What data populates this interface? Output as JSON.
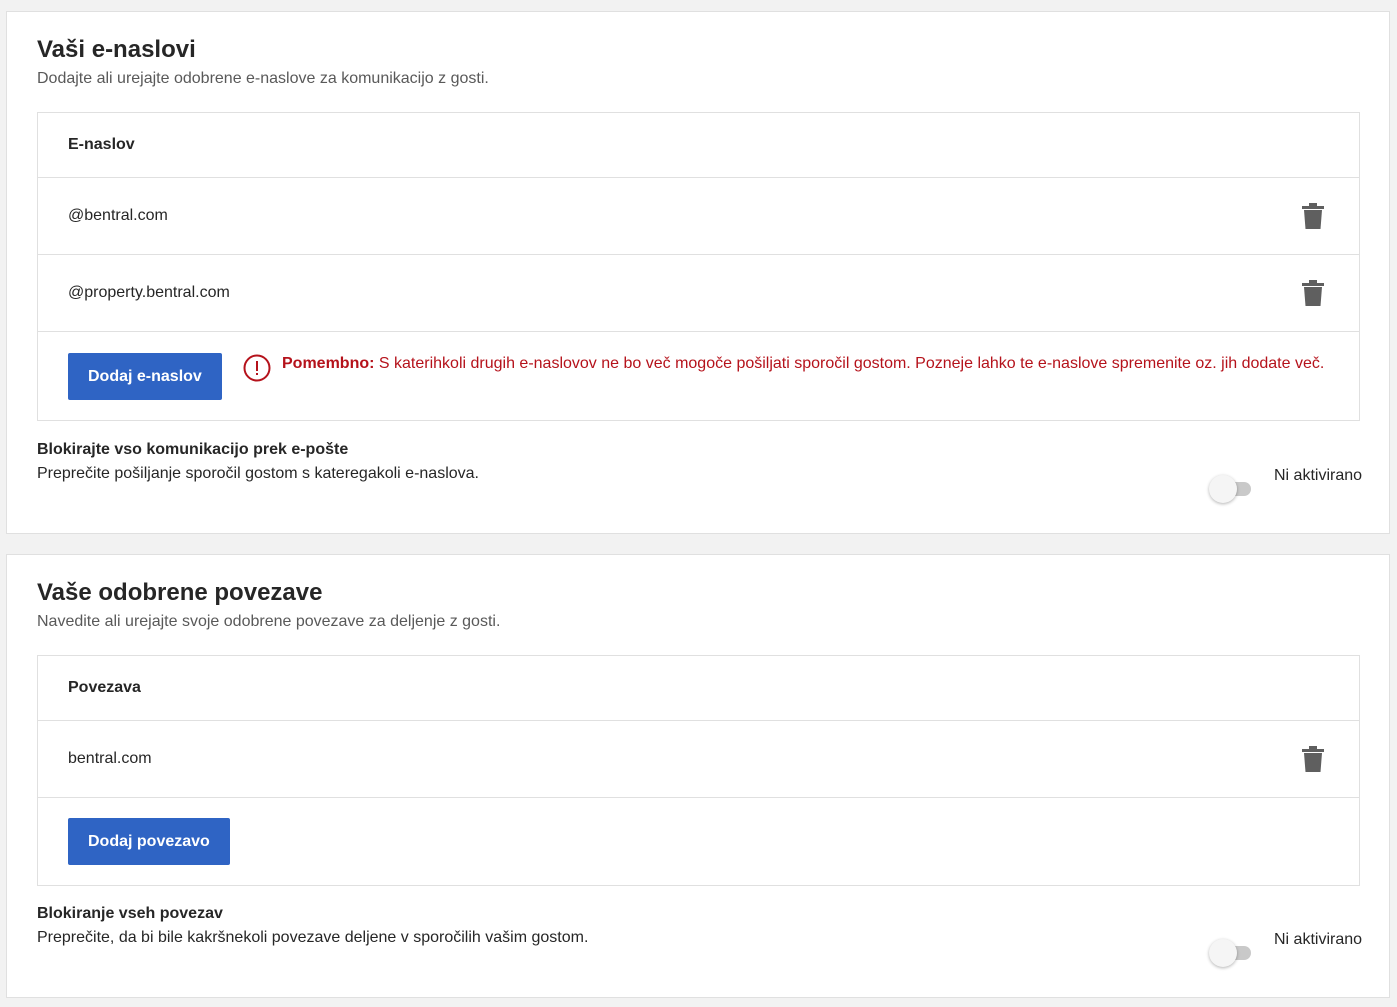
{
  "email_section": {
    "title": "Vaši e-naslovi",
    "subtitle": "Dodajte ali urejajte odobrene e-naslove za komunikacijo z gosti.",
    "table_header": "E-naslov",
    "items": [
      "@bentral.com",
      "@property.bentral.com"
    ],
    "add_button": "Dodaj e-naslov",
    "warning_strong": "Pomembno:",
    "warning_text": "S katerihkoli drugih e-naslovov ne bo več mogoče pošiljati sporočil gostom. Pozneje lahko te e-naslove spremenite oz. jih dodate več.",
    "block_title": "Blokirajte vso komunikacijo prek e-pošte",
    "block_desc": "Preprečite pošiljanje sporočil gostom s kateregakoli e-naslova.",
    "toggle_label": "Ni aktivirano",
    "toggle_on": false
  },
  "links_section": {
    "title": "Vaše odobrene povezave",
    "subtitle": "Navedite ali urejajte svoje odobrene povezave za deljenje z gosti.",
    "table_header": "Povezava",
    "items": [
      "bentral.com"
    ],
    "add_button": "Dodaj povezavo",
    "block_title": "Blokiranje vseh povezav",
    "block_desc": "Preprečite, da bi bile kakršnekoli povezave deljene v sporočilih vašim gostom.",
    "toggle_label": "Ni aktivirano",
    "toggle_on": false
  },
  "colors": {
    "primary_button": "#2f64c4",
    "warning": "#b5121b",
    "icon_gray": "#5f5f5f"
  },
  "icons": {
    "delete": "trash-icon",
    "warning": "exclamation-circle-icon"
  }
}
